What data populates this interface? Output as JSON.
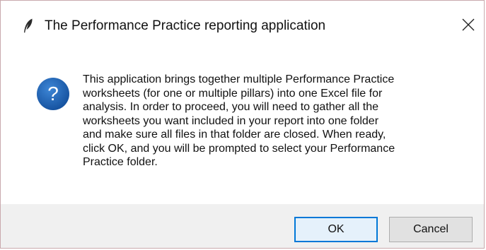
{
  "window": {
    "title": "The Performance Practice reporting application",
    "app_icon": "feather-icon",
    "close_icon": "close-icon"
  },
  "message": {
    "icon": "question-icon",
    "icon_glyph": "?",
    "icon_color": "#1a5fb4",
    "lines": [
      "This application brings together multiple Performance Practice",
      "worksheets (for one or multiple pillars) into one Excel file for",
      "analysis. In order to proceed, you will need to gather all the",
      "worksheets you want included in your report into one folder",
      "and make sure all files in that folder are closed. When ready,",
      "click OK, and you will be prompted to select your Performance",
      "Practice folder."
    ]
  },
  "buttons": {
    "ok_label": "OK",
    "cancel_label": "Cancel",
    "ok_border_color": "#0078d7"
  }
}
